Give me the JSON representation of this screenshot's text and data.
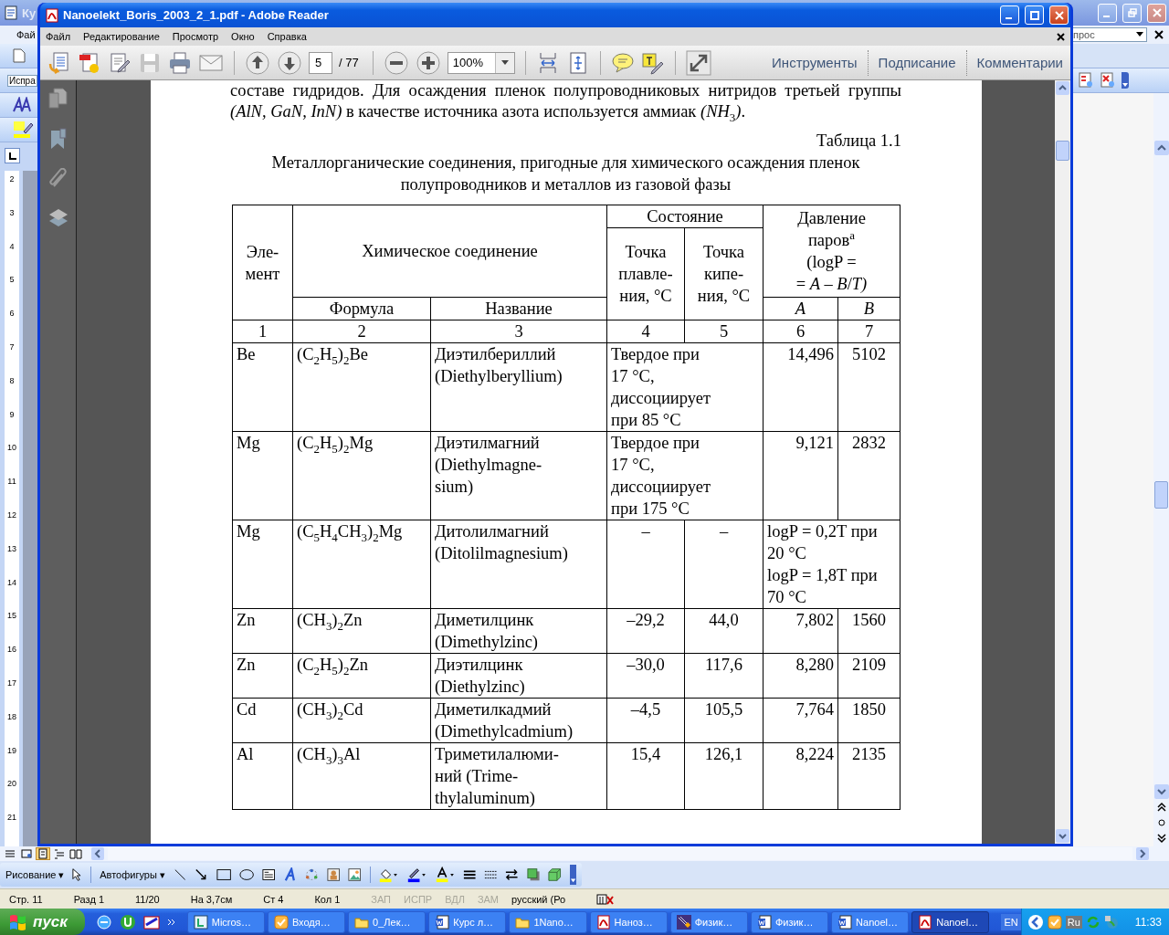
{
  "word_window": {
    "title": "Ку",
    "menu": [
      "Фай"
    ],
    "style_box": "Испра",
    "search_field": {
      "value": "прос"
    },
    "ruler_marks": [
      "2",
      "3",
      "4",
      "5",
      "6",
      "7",
      "8",
      "9",
      "10",
      "11",
      "12",
      "13",
      "14",
      "15",
      "16",
      "17",
      "18",
      "19",
      "20",
      "21"
    ],
    "drawing_toolbar": {
      "drawing_menu": "Рисование ▾",
      "autoshapes_menu": "Автофигуры ▾"
    },
    "status_bar": [
      {
        "text": "Стр. 11",
        "active": true
      },
      {
        "text": "Разд 1",
        "active": true
      },
      {
        "text": "11/20",
        "active": true
      },
      {
        "text": "На 3,7см",
        "active": true
      },
      {
        "text": "Ст 4",
        "active": true
      },
      {
        "text": "Кол 1",
        "active": true
      },
      {
        "text": "ЗАП",
        "active": false
      },
      {
        "text": "ИСПР",
        "active": false
      },
      {
        "text": "ВДЛ",
        "active": false
      },
      {
        "text": "ЗАМ",
        "active": false
      },
      {
        "text": "русский (Ро",
        "active": true
      }
    ]
  },
  "reader_window": {
    "title": "Nanoelekt_Boris_2003_2_1.pdf - Adobe Reader",
    "menu": [
      "Файл",
      "Редактирование",
      "Просмотр",
      "Окно",
      "Справка"
    ],
    "toolbar": {
      "save_disabled": true,
      "page": "5",
      "page_count": "/ 77",
      "zoom": "100%"
    },
    "panel_links": [
      "Инструменты",
      "Подписание",
      "Комментарии"
    ],
    "document": {
      "paragraph": "составе гидридов. Для осаждения пленок полупроводниковых нитридов третьей группы *(AlN, GaN, InN)* в качестве источника азота используется аммиак *(NH*$_{3}$*)*.",
      "table_label": "Таблица 1.1",
      "table_caption": "Металлорганические соединения, пригодные для химического осаждения пленок полупроводников и металлов из газовой фазы",
      "table": {
        "header": {
          "element": "Эле-\nмент",
          "compound": "Химическое соединение",
          "state": "Состояние",
          "melting": "Точка\nплавле-\nния, °C",
          "boiling": "Точка\nкипе-\nния, °C",
          "pressure": "Давление\nпаров$^{a}$\n(logP =\n= *A – B*/*T)*",
          "formula": "Формула",
          "name": "Название",
          "a": "A",
          "b": "B"
        },
        "column_numbers": [
          "1",
          "2",
          "3",
          "4",
          "5",
          "6",
          "7"
        ],
        "rows": [
          {
            "kind": "state_note",
            "element": "Be",
            "formula": "(C$_{2}$H$_{5}$)$_{2}$Be",
            "name": "Диэтилбериллий\n(Diethylberyllium)",
            "state": "Твердое при\n17 °C,\nдиссоциирует\nпри 85 °C",
            "a": "14,496",
            "b": "5102"
          },
          {
            "kind": "state_note",
            "element": "Mg",
            "formula": "(C$_{2}$H$_{5}$)$_{2}$Mg",
            "name": "Диэтилмагний\n(Diethylmagne-\nsium)",
            "state": "Твердое при\n17 °C,\nдиссоциирует\nпри 175 °C",
            "a": "9,121",
            "b": "2832"
          },
          {
            "kind": "pressure_note",
            "element": "Mg",
            "formula": "(C$_{5}$H$_{4}$CH$_{3}$)$_{2}$Mg",
            "name": "Дитолилмагний\n(Ditolilmagnesium)",
            "melting": "–",
            "boiling": "–",
            "pressure": "logP = 0,2T при\n20 °C\nlogP = 1,8T при\n70 °C"
          },
          {
            "kind": "values",
            "element": "Zn",
            "formula": "(CH$_{3}$)$_{2}$Zn",
            "name": "Диметилцинк\n(Dimethylzinc)",
            "melting": "–29,2",
            "boiling": "44,0",
            "a": "7,802",
            "b": "1560"
          },
          {
            "kind": "values",
            "element": "Zn",
            "formula": "(C$_{2}$H$_{5}$)$_{2}$Zn",
            "name": "Диэтилцинк\n(Diethylzinc)",
            "melting": "–30,0",
            "boiling": "117,6",
            "a": "8,280",
            "b": "2109"
          },
          {
            "kind": "values",
            "element": "Cd",
            "formula": "(CH$_{3}$)$_{2}$Cd",
            "name": "Диметилкадмий\n(Dimethylcadmium)",
            "melting": "–4,5",
            "boiling": "105,5",
            "a": "7,764",
            "b": "1850"
          },
          {
            "kind": "values",
            "element": "Al",
            "formula": "(CH$_{3}$)$_{3}$Al",
            "name": "Триметилалюми-\nний (Trime-\nthylaluminum)",
            "melting": "15,4",
            "boiling": "126,1",
            "a": "8,224",
            "b": "2135"
          }
        ]
      }
    }
  },
  "taskbar": {
    "start": "пуск",
    "tasks": [
      {
        "label": "Micros…",
        "kind": "app",
        "selected": false
      },
      {
        "label": "Входя…",
        "kind": "mail",
        "selected": false
      },
      {
        "label": "0_Лек…",
        "kind": "folder",
        "selected": false
      },
      {
        "label": "Курс л…",
        "kind": "word",
        "selected": false
      },
      {
        "label": "1Nano…",
        "kind": "folder",
        "selected": false
      },
      {
        "label": "Наноз…",
        "kind": "pdf",
        "selected": false
      },
      {
        "label": "Физик…",
        "kind": "math",
        "selected": false
      },
      {
        "label": "Физик…",
        "kind": "word",
        "selected": false
      },
      {
        "label": "Nanoel…",
        "kind": "word",
        "selected": false
      },
      {
        "label": "Nanoel…",
        "kind": "pdf",
        "selected": true
      }
    ],
    "language": "EN",
    "tray_language": "Ru",
    "clock": "11:33"
  }
}
